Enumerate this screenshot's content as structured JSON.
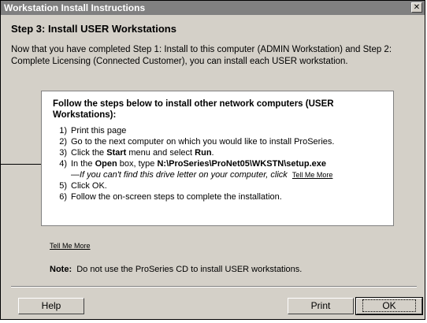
{
  "window": {
    "title": "Workstation Install Instructions",
    "close_glyph": "✕"
  },
  "step_title": "Step 3:  Install USER Workstations",
  "intro": "Now that you have completed Step 1: Install to this computer (ADMIN Workstation) and Step 2: Complete Licensing (Connected Customer), you can install each USER workstation.",
  "panel": {
    "heading": "Follow the steps below to install other network computers (USER Workstations):",
    "steps": [
      {
        "num": "1)",
        "text": "Print this page"
      },
      {
        "num": "2)",
        "text": "Go to the next computer on which you would like to install ProSeries."
      },
      {
        "num": "3)",
        "pre": "Click the ",
        "bold1": "Start",
        "mid": " menu and select ",
        "bold2": "Run",
        "post": "."
      },
      {
        "num": "4)",
        "pre": "In the ",
        "bold1": "Open",
        "mid": " box, type ",
        "bold2": "N:\\ProSeries\\ProNet05\\WKSTN\\setup.exe",
        "post": ""
      },
      {
        "sub": "—If you can't find this drive letter on your computer, click",
        "link": "Tell Me More"
      },
      {
        "num": "5)",
        "text": "Click OK."
      },
      {
        "num": "6)",
        "text": "Follow the on-screen steps to complete the installation."
      }
    ]
  },
  "tell_me_more": "Tell Me More",
  "note": {
    "label": "Note:",
    "text": "Do not use the ProSeries CD to install USER workstations."
  },
  "buttons": {
    "help": "Help",
    "print": "Print",
    "ok": "OK"
  }
}
